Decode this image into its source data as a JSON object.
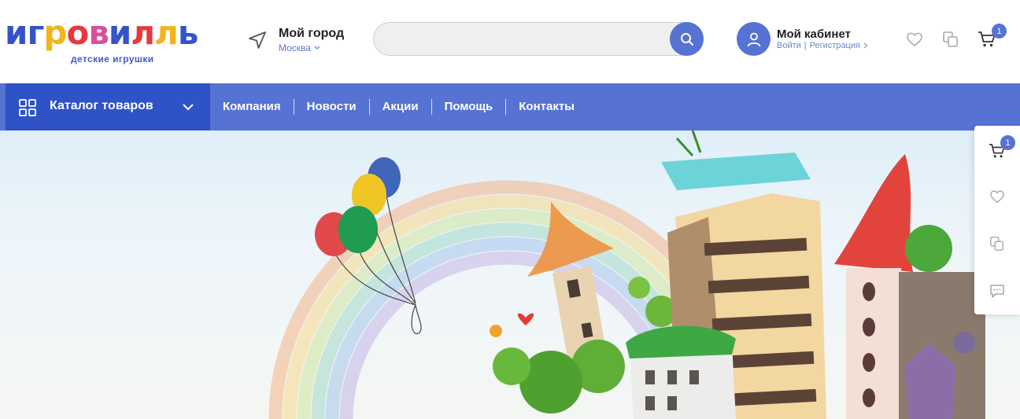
{
  "header": {
    "logo": {
      "letters": [
        "и",
        "г",
        "р",
        "о",
        "в",
        "и",
        "л",
        "л",
        "ь"
      ],
      "letter_colors": [
        "#3553c8",
        "#3553c8",
        "#f0b51a",
        "#e8383d",
        "#d94f9c",
        "#3553c8",
        "#e8383d",
        "#f0b51a",
        "#3553c8"
      ],
      "subtitle": "детские игрушки"
    },
    "city": {
      "title": "Мой город",
      "name": "Москва",
      "icon": "location-arrow-icon"
    },
    "search": {
      "value": "",
      "placeholder": "",
      "icon": "search-icon"
    },
    "account": {
      "title": "Мой кабинет",
      "login": "Войти",
      "separator": "|",
      "register": "Регистрация",
      "icon": "user-icon"
    },
    "icons": {
      "favorites": "heart-icon",
      "compare": "compare-icon",
      "cart": "cart-icon"
    },
    "cart_count": "1"
  },
  "nav": {
    "catalog_label": "Каталог товаров",
    "items": [
      "Компания",
      "Новости",
      "Акции",
      "Помощь",
      "Контакты"
    ]
  },
  "side_panel": {
    "cart_count": "1",
    "icons": [
      "cart-icon",
      "heart-icon",
      "compare-icon",
      "chat-icon"
    ]
  },
  "colors": {
    "brand_blue": "#5672d3",
    "dark_blue": "#2f52c6"
  }
}
